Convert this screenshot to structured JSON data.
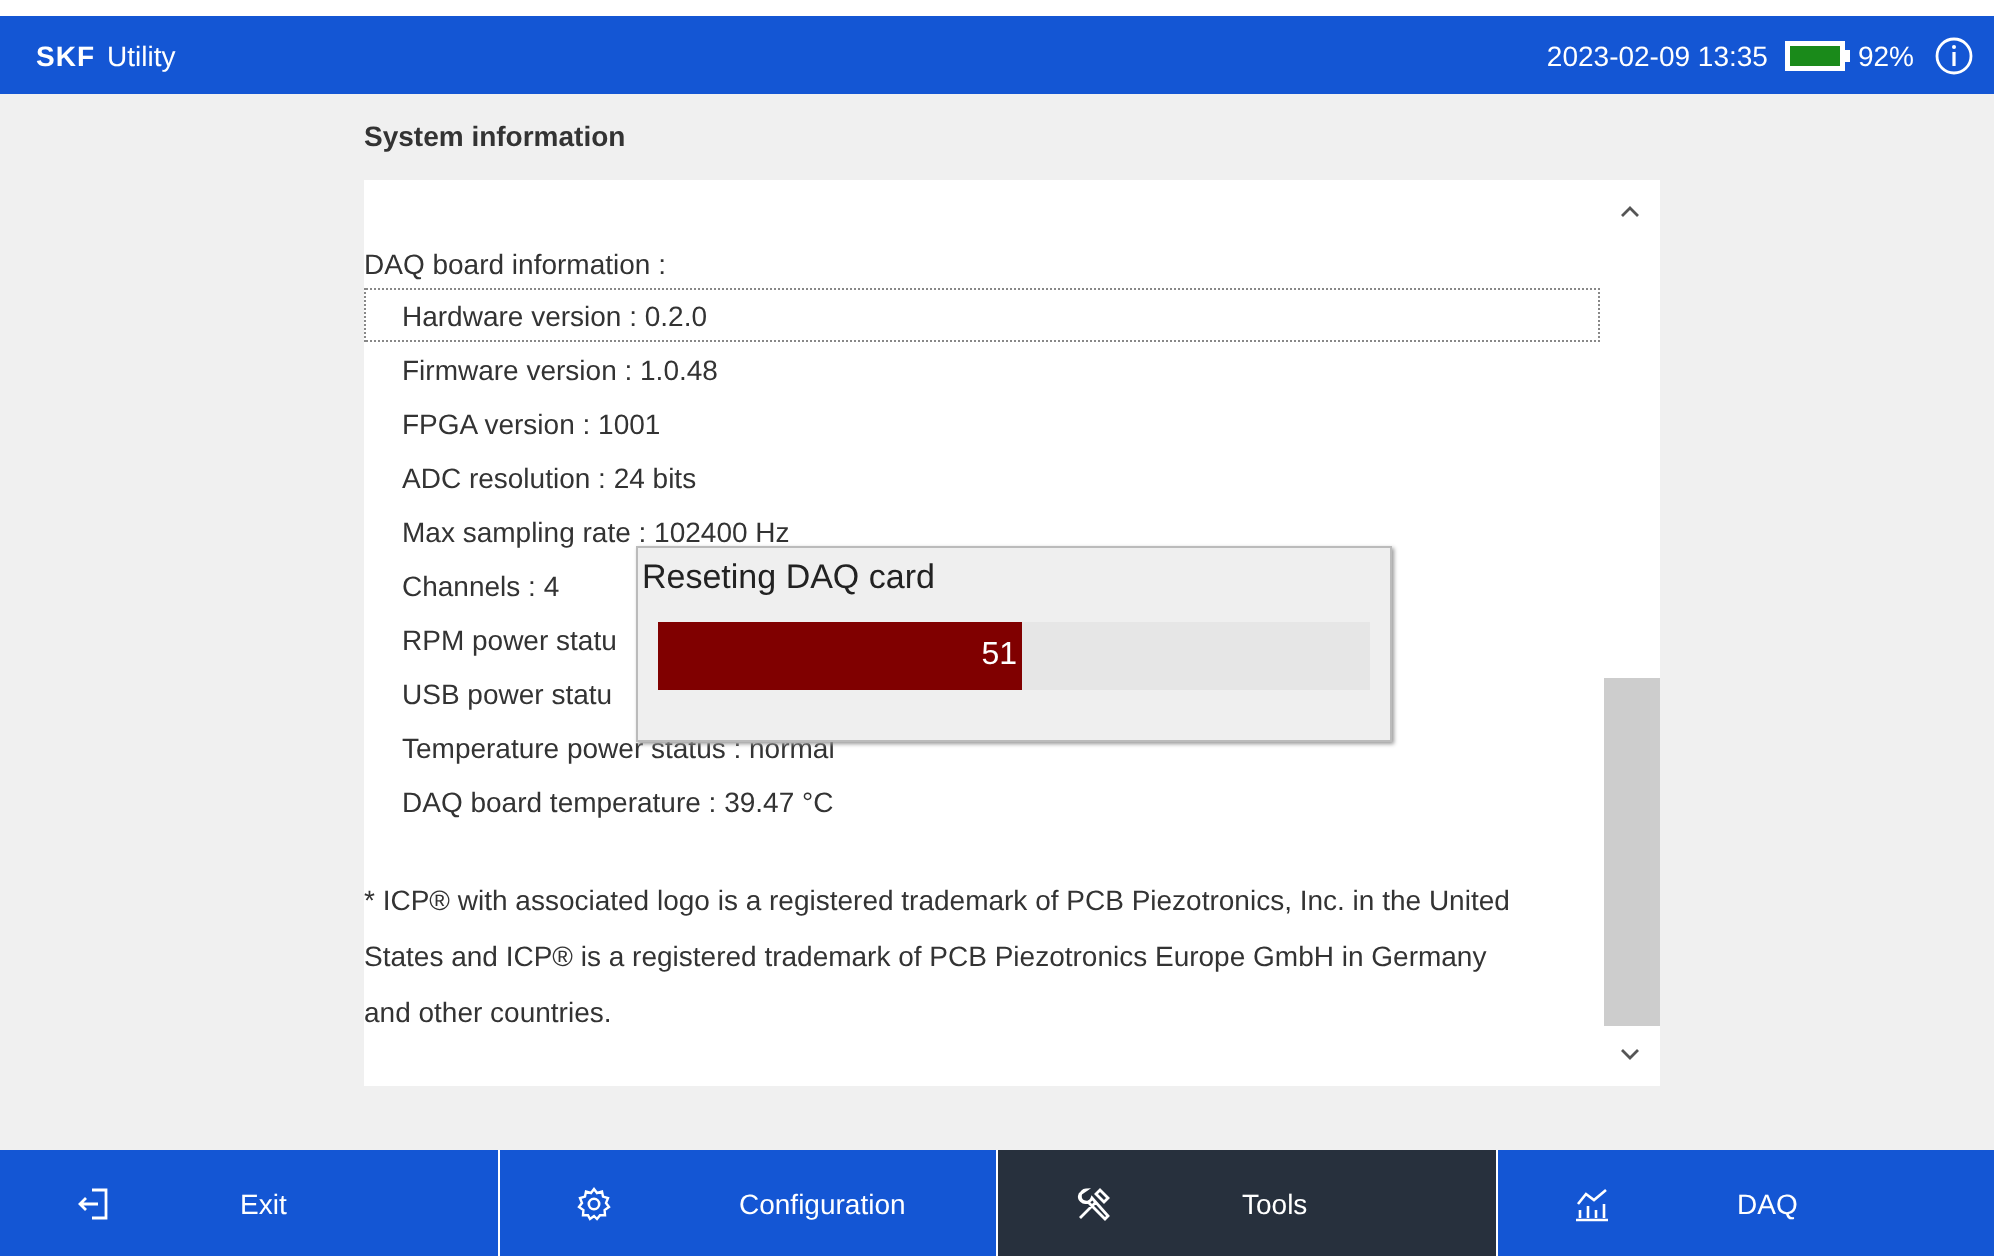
{
  "top_bar": {
    "logo": "SKF",
    "app_name": "Utility",
    "datetime": "2023-02-09 13:35",
    "battery": "92%"
  },
  "page": {
    "title": "System information",
    "section_label": "DAQ board information :",
    "rows": [
      {
        "text": "Hardware version : 0.2.0",
        "focused": true
      },
      {
        "text": "Firmware version : 1.0.48",
        "focused": false
      },
      {
        "text": "FPGA version : 1001",
        "focused": false
      },
      {
        "text": "ADC resolution : 24 bits",
        "focused": false
      },
      {
        "text": "Max sampling rate : 102400 Hz",
        "focused": false
      },
      {
        "text": "Channels : 4",
        "focused": false
      },
      {
        "text": "RPM power statu",
        "focused": false
      },
      {
        "text": "USB power statu",
        "focused": false
      },
      {
        "text": "Temperature power status : normal",
        "focused": false
      },
      {
        "text": "DAQ board temperature : 39.47 °C",
        "focused": false
      }
    ],
    "footnote": "* ICP® with associated logo is a registered trademark of PCB Piezotronics, Inc. in the United States and ICP® is a registered trademark of PCB Piezotronics Europe GmbH in Germany and other countries."
  },
  "dialog": {
    "title": "Reseting DAQ card",
    "progress": {
      "level": 0.51,
      "reading": "51"
    }
  },
  "nav": [
    {
      "kind": "exit",
      "label": "Exit",
      "selected": false
    },
    {
      "kind": "gear",
      "label": "Configuration",
      "selected": false
    },
    {
      "kind": "tools",
      "label": "Tools",
      "selected": true
    },
    {
      "kind": "chart",
      "label": "DAQ",
      "selected": false
    }
  ]
}
